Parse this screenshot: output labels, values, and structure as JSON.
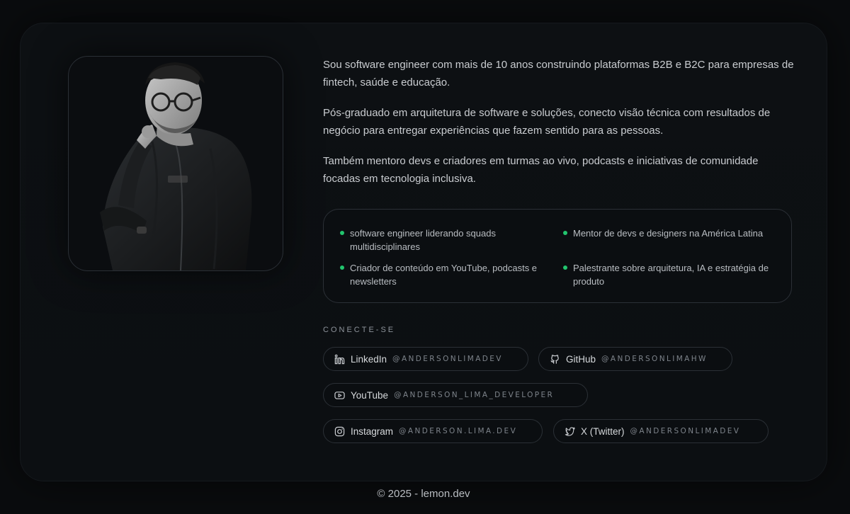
{
  "about": {
    "paragraphs": [
      "Sou software engineer com mais de 10 anos construindo plataformas B2B e B2C para empresas de fintech, saúde e educação.",
      "Pós-graduado em arquitetura de software e soluções, conecto visão técnica com resultados de negócio para entregar experiências que fazem sentido para as pessoas.",
      "Também mentoro devs e criadores em turmas ao vivo, podcasts e iniciativas de comunidade focadas em tecnologia inclusiva."
    ],
    "highlights": [
      "software engineer liderando squads multidisciplinares",
      "Mentor de devs e designers na América Latina",
      "Criador de conteúdo em YouTube, podcasts e newsletters",
      "Palestrante sobre arquitetura, IA e estratégia de produto"
    ],
    "accent_color": "#22c56e"
  },
  "connect": {
    "title": "CONECTE-SE",
    "links": [
      {
        "name": "LinkedIn",
        "handle": "@ANDERSONLIMADEV",
        "icon": "linkedin-icon"
      },
      {
        "name": "GitHub",
        "handle": "@ANDERSONLIMAHW",
        "icon": "github-icon"
      },
      {
        "name": "YouTube",
        "handle": "@ANDERSON_LIMA_DEVELOPER",
        "icon": "youtube-icon"
      },
      {
        "name": "Instagram",
        "handle": "@ANDERSON.LIMA.DEV",
        "icon": "instagram-icon"
      },
      {
        "name": "X (Twitter)",
        "handle": "@ANDERSONLIMADEV",
        "icon": "twitter-icon"
      }
    ]
  },
  "footer": {
    "text": "© 2025 - lemon.dev"
  }
}
